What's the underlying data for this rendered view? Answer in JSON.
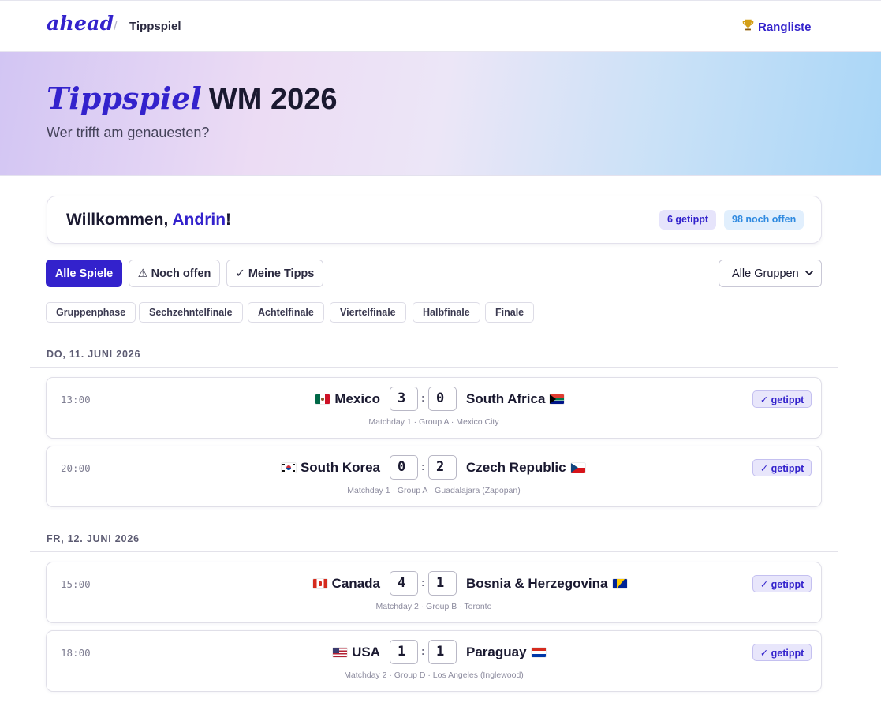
{
  "header": {
    "logo": "ahead",
    "separator": "/",
    "breadcrumb": "Tippspiel",
    "rank_link": "Rangliste",
    "rank_icon": "trophy-icon"
  },
  "hero": {
    "title_accent": "Tippspiel",
    "title_rest": "WM 2026",
    "subtitle": "Wer trifft am genauesten?"
  },
  "welcome": {
    "greeting": "Willkommen, ",
    "name": "Andrin",
    "suffix": "!",
    "tipped_badge": "6 getippt",
    "open_badge": "98 noch offen"
  },
  "filters": {
    "all": "Alle Spiele",
    "open": "⚠ Noch offen",
    "mine": "✓ Meine Tipps",
    "group_select": "Alle Gruppen"
  },
  "stages": [
    "Gruppenphase",
    "Sechzehntelfinale",
    "Achtelfinale",
    "Viertelfinale",
    "Halbfinale",
    "Finale"
  ],
  "days": [
    {
      "label": "DO, 11. JUNI 2026",
      "matches": [
        {
          "time": "13:00",
          "home": "Mexico",
          "home_flag": "mexico-flag-icon",
          "home_score": "3",
          "away": "South Africa",
          "away_flag": "south-africa-flag-icon",
          "away_score": "0",
          "meta": "Matchday 1 · Group A · Mexico City",
          "status": "✓ getippt"
        },
        {
          "time": "20:00",
          "home": "South Korea",
          "home_flag": "south-korea-flag-icon",
          "home_score": "0",
          "away": "Czech Republic",
          "away_flag": "czech-republic-flag-icon",
          "away_score": "2",
          "meta": "Matchday 1 · Group A · Guadalajara (Zapopan)",
          "status": "✓ getippt"
        }
      ]
    },
    {
      "label": "FR, 12. JUNI 2026",
      "matches": [
        {
          "time": "15:00",
          "home": "Canada",
          "home_flag": "canada-flag-icon",
          "home_score": "4",
          "away": "Bosnia & Herzegovina",
          "away_flag": "bosnia-flag-icon",
          "away_score": "1",
          "meta": "Matchday 2 · Group B · Toronto",
          "status": "✓ getippt"
        },
        {
          "time": "18:00",
          "home": "USA",
          "home_flag": "usa-flag-icon",
          "home_score": "1",
          "away": "Paraguay",
          "away_flag": "paraguay-flag-icon",
          "away_score": "1",
          "meta": "Matchday 2 · Group D · Los Angeles (Inglewood)",
          "status": "✓ getippt"
        }
      ]
    }
  ],
  "colors": {
    "accent": "#3322cc",
    "open_blue": "#2f8ae0"
  }
}
